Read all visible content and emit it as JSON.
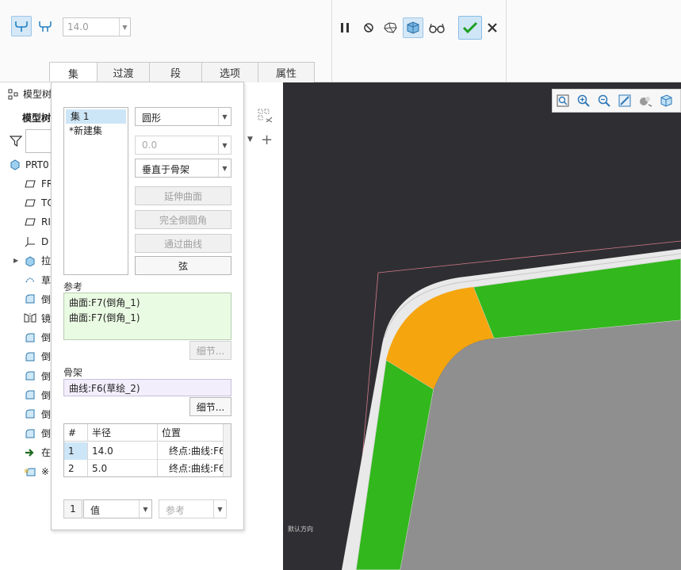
{
  "ribbon": {
    "radius_value": "14.0",
    "tabs": [
      {
        "label": "集"
      },
      {
        "label": "过渡"
      },
      {
        "label": "段"
      },
      {
        "label": "选项"
      },
      {
        "label": "属性"
      }
    ]
  },
  "tree": {
    "title": "模型树",
    "header": "模型树",
    "root": "PRT0",
    "items": [
      {
        "label": "FR",
        "icon": "datum-plane-icon"
      },
      {
        "label": "TO",
        "icon": "datum-plane-icon"
      },
      {
        "label": "RI",
        "icon": "datum-plane-icon"
      },
      {
        "label": "D",
        "icon": "coordinate-system-icon"
      },
      {
        "label": "拉",
        "icon": "extrude-icon"
      },
      {
        "label": "草",
        "icon": "sketch-icon"
      },
      {
        "label": "倒",
        "icon": "round-icon"
      },
      {
        "label": "镜",
        "icon": "mirror-icon"
      },
      {
        "label": "倒",
        "icon": "round-icon"
      },
      {
        "label": "倒",
        "icon": "round-icon"
      },
      {
        "label": "倒",
        "icon": "round-icon"
      },
      {
        "label": "倒",
        "icon": "round-icon"
      },
      {
        "label": "倒",
        "icon": "round-icon"
      },
      {
        "label": "倒",
        "icon": "round-icon"
      },
      {
        "label": "在",
        "icon": "insert-here-arrow-icon"
      },
      {
        "label": "※",
        "icon": "round-in-progress-icon"
      }
    ]
  },
  "sets_panel": {
    "sets": [
      "集 1",
      "*新建集"
    ],
    "shape": "圆形",
    "value": "0.0",
    "section_method": "垂直于骨架",
    "buttons": {
      "extend_surfaces": "延伸曲面",
      "full_round": "完全倒圆角",
      "through_curve": "通过曲线",
      "chordal": "弦"
    },
    "references_label": "参考",
    "references": [
      "曲面:F7(倒角_1)",
      "曲面:F7(倒角_1)"
    ],
    "details_label": "细节...",
    "spine_label": "骨架",
    "spine": "曲线:F6(草绘_2)",
    "radius_table": {
      "headers": [
        "#",
        "半径",
        "位置"
      ],
      "rows": [
        {
          "index": "1",
          "radius": "14.0",
          "location": "终点:曲线:F6"
        },
        {
          "index": "2",
          "radius": "5.0",
          "location": "终点:曲线:F6"
        }
      ]
    },
    "bottom": {
      "count": "1",
      "mode": "值",
      "reference": "参考"
    }
  },
  "graphics": {
    "orientation_text": "默认方向"
  },
  "colors": {
    "green_face": "#32b71c",
    "orange_face": "#f5a50e",
    "gray_face": "#8f8f8f",
    "background": "#2f2f33"
  }
}
